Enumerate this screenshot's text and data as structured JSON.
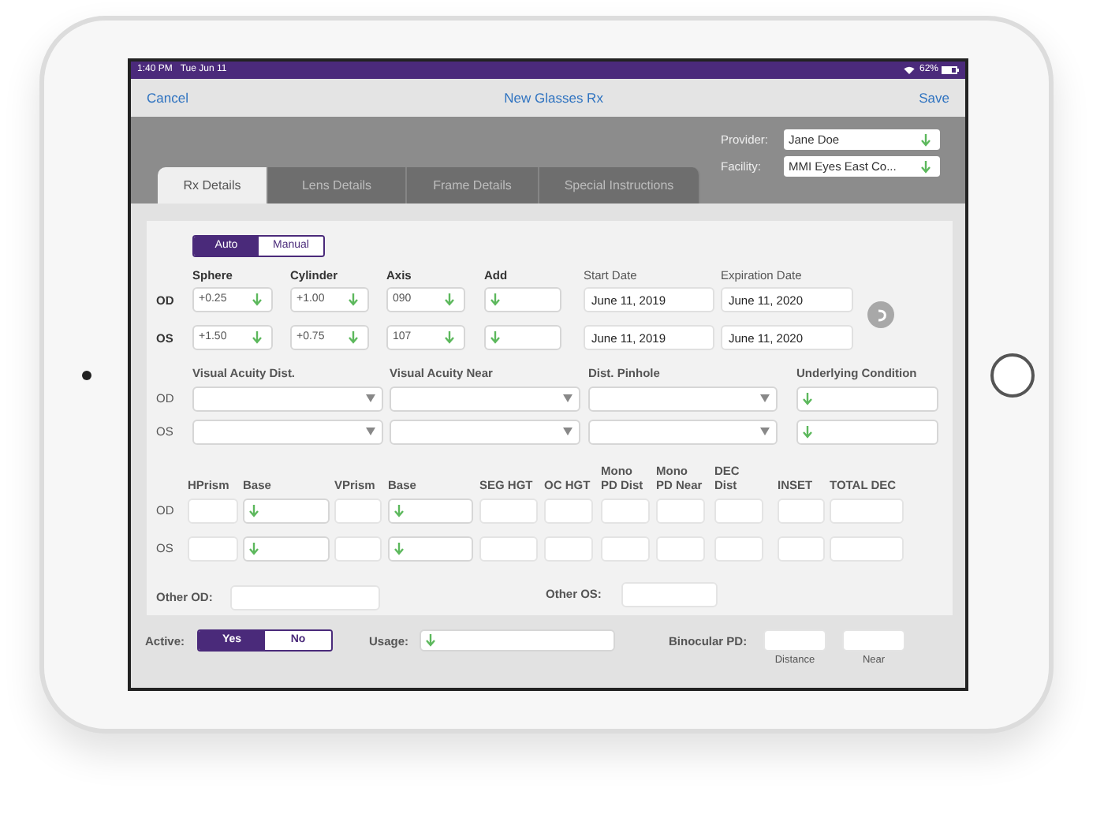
{
  "status_bar": {
    "time": "1:40 PM",
    "date": "Tue Jun 11",
    "battery": "62%"
  },
  "nav": {
    "cancel": "Cancel",
    "title": "New Glasses Rx",
    "save": "Save"
  },
  "provider": {
    "label": "Provider:",
    "value": "Jane Doe"
  },
  "facility": {
    "label": "Facility:",
    "value": "MMI Eyes East Co..."
  },
  "tabs": [
    {
      "label": "Rx Details",
      "selected": true
    },
    {
      "label": "Lens Details",
      "selected": false
    },
    {
      "label": "Frame Details",
      "selected": false
    },
    {
      "label": "Special Instructions",
      "selected": false
    }
  ],
  "mode_toggle": [
    {
      "label": "Auto",
      "selected": true
    },
    {
      "label": "Manual",
      "selected": false
    }
  ],
  "rx": {
    "columns": [
      {
        "label": "Sphere",
        "kind": "picker"
      },
      {
        "label": "Cylinder",
        "kind": "picker"
      },
      {
        "label": "Axis",
        "kind": "picker"
      },
      {
        "label": "Add",
        "kind": "picker"
      },
      {
        "label": "Start Date",
        "kind": "date"
      },
      {
        "label": "Expiration Date",
        "kind": "date"
      }
    ],
    "rows": [
      {
        "eye": "OD",
        "sphere": "+0.25",
        "cylinder": "+1.00",
        "axis": "090",
        "start_date": "June 11, 2019",
        "expiration_date": "June 11, 2020"
      },
      {
        "eye": "OS",
        "sphere": "+1.50",
        "cylinder": "+0.75",
        "axis": "107",
        "start_date": "June 11, 2019",
        "expiration_date": "June 11, 2020"
      }
    ]
  },
  "acuity": {
    "columns": [
      {
        "label": "Visual Acuity Dist.",
        "kind": "menu"
      },
      {
        "label": "Visual Acuity Near",
        "kind": "menu"
      },
      {
        "label": "Dist. Pinhole",
        "kind": "menu"
      },
      {
        "label": "Underlying Condition",
        "kind": "picker"
      }
    ],
    "rows": [
      "OD",
      "OS"
    ]
  },
  "prism": {
    "columns": [
      {
        "label": "HPrism",
        "kind": "text"
      },
      {
        "label": "Base",
        "kind": "picker"
      },
      {
        "label": "VPrism",
        "kind": "text"
      },
      {
        "label": "Base",
        "kind": "picker"
      },
      {
        "label": "SEG HGT",
        "kind": "text"
      },
      {
        "label": "OC HGT",
        "kind": "text"
      },
      {
        "label": "Mono PD Dist",
        "kind": "text"
      },
      {
        "label": "Mono PD Near",
        "kind": "text"
      },
      {
        "label": "DEC Dist",
        "kind": "text"
      },
      {
        "label": "INSET",
        "kind": "text"
      },
      {
        "label": "TOTAL DEC",
        "kind": "text"
      }
    ],
    "rows": [
      "OD",
      "OS"
    ]
  },
  "other": [
    {
      "label": "Other OD:"
    },
    {
      "label": "Other OS:"
    }
  ],
  "active": {
    "label": "Active:",
    "options": [
      {
        "label": "Yes",
        "selected": true
      },
      {
        "label": "No",
        "selected": false
      }
    ]
  },
  "usage": {
    "label": "Usage:"
  },
  "binocular_pd": {
    "label": "Binocular PD:",
    "fields": [
      {
        "caption": "Distance"
      },
      {
        "caption": "Near"
      }
    ]
  }
}
